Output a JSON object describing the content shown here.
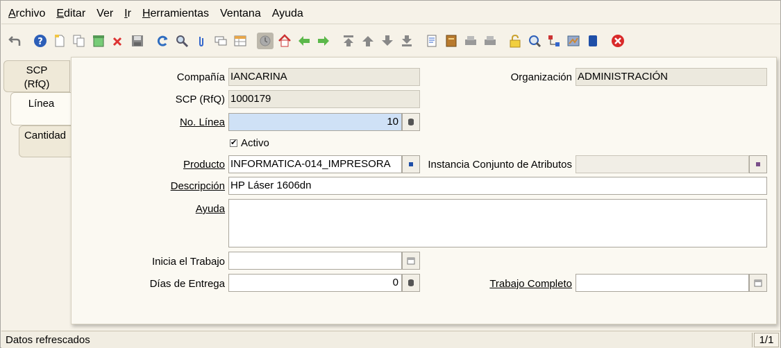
{
  "menu": [
    "Archivo",
    "Editar",
    "Ver",
    "Ir",
    "Herramientas",
    "Ventana",
    "Ayuda"
  ],
  "toolbar_icons": [
    "undo-icon",
    "help-icon",
    "new-record-icon",
    "copy-record-icon",
    "save-and-new-icon",
    "delete-icon",
    "save-icon",
    "refresh-icon",
    "find-icon",
    "attachment-icon",
    "chat-icon",
    "grid-toggle-icon",
    "history-icon",
    "home-icon",
    "back-icon",
    "forward-icon",
    "first-record-icon",
    "previous-record-icon",
    "next-record-icon",
    "last-record-icon",
    "report-icon",
    "archive-icon",
    "print-preview-icon",
    "print-icon",
    "lock-icon",
    "zoom-across-icon",
    "workflow-icon",
    "product-info-icon",
    "active-workflows-icon",
    "exit-icon"
  ],
  "tabs": [
    "SCP\n(RfQ)",
    "Línea",
    "Cantidad"
  ],
  "form": {
    "compania_label": "Compañía",
    "compania_value": "IANCARINA",
    "organizacion_label": "Organización",
    "organizacion_value": "ADMINISTRACIÓN",
    "scp_label": "SCP (RfQ)",
    "scp_value": "1000179",
    "linea_label": "No. Línea",
    "linea_value": "10",
    "activo_label": "Activo",
    "activo_checked": true,
    "producto_label": "Producto",
    "producto_value": "INFORMATICA-014_IMPRESORA",
    "instancia_label": "Instancia Conjunto de Atributos",
    "instancia_value": "",
    "descripcion_label": "Descripción",
    "descripcion_value": "HP Láser 1606dn",
    "ayuda_label": "Ayuda",
    "ayuda_value": "",
    "inicia_label": "Inicia el Trabajo",
    "inicia_value": "",
    "dias_label": "Días de Entrega",
    "dias_value": "0",
    "trabajo_label": "Trabajo Completo",
    "trabajo_value": ""
  },
  "status": {
    "message": "Datos refrescados",
    "record_count": "1/1"
  },
  "colors": {
    "mandatory_field": "#cfe1f6",
    "readonly_field": "#ece9de",
    "background": "#f6f2e8"
  }
}
